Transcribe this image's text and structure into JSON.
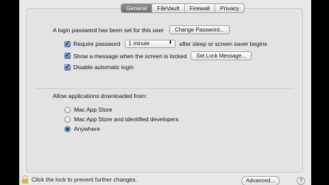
{
  "tabs": [
    {
      "label": "General",
      "active": true
    },
    {
      "label": "FileVault",
      "active": false
    },
    {
      "label": "Firewall",
      "active": false
    },
    {
      "label": "Privacy",
      "active": false
    }
  ],
  "general": {
    "login_password_text": "A login password has been set for this user",
    "change_password_button": "Change Password...",
    "require_password": {
      "label": "Require password",
      "checked": true
    },
    "require_password_select": "1 minute",
    "require_password_suffix": "after sleep or screen saver begins",
    "show_message": {
      "label": "Show a message when the screen is locked",
      "checked": true
    },
    "set_lock_message_button": "Set Lock Message...",
    "disable_auto_login": {
      "label": "Disable automatic login",
      "checked": true
    }
  },
  "downloads": {
    "heading": "Allow applications downloaded from:",
    "options": [
      {
        "label": "Mac App Store",
        "selected": false
      },
      {
        "label": "Mac App Store and identified developers",
        "selected": false
      },
      {
        "label": "Anywhere",
        "selected": true
      }
    ]
  },
  "bottom": {
    "lock_text": "Click the lock to prevent further changes.",
    "advanced_button": "Advanced...",
    "help_button": "?"
  }
}
